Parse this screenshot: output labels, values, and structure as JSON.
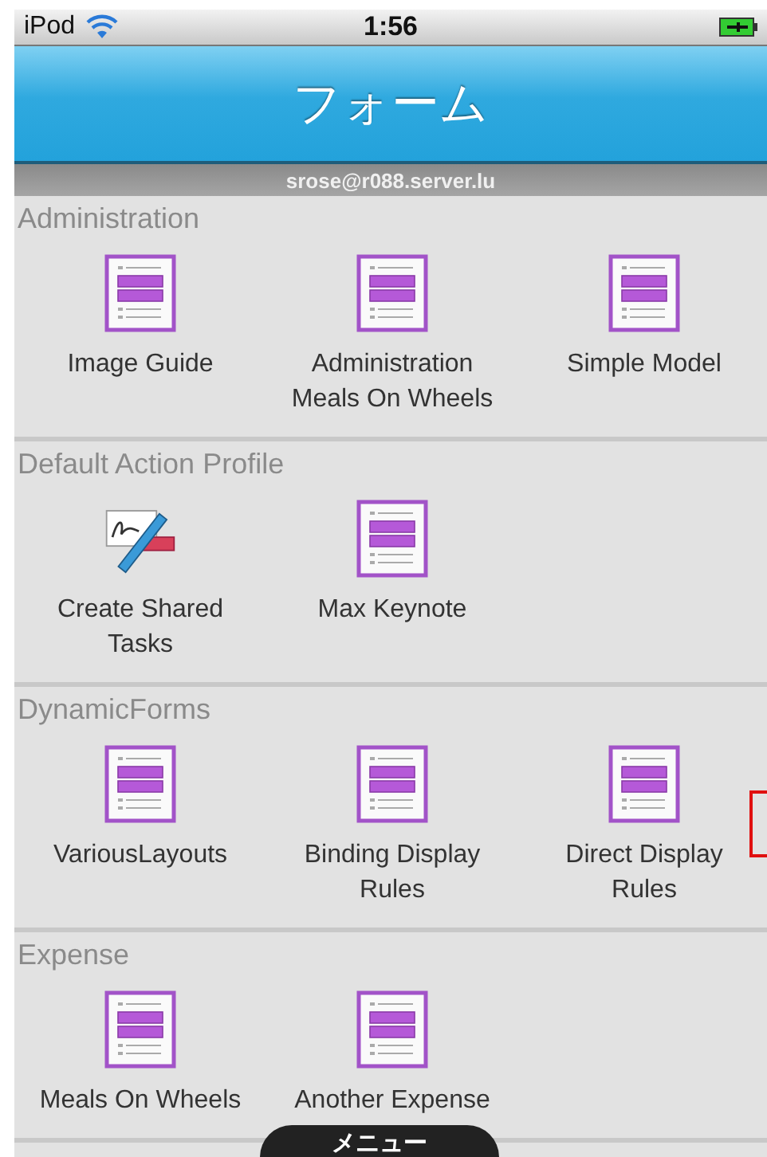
{
  "status_bar": {
    "carrier": "iPod",
    "time": "1:56"
  },
  "nav_bar": {
    "title": "フォーム"
  },
  "account": "srose@r088.server.lu",
  "sections": [
    {
      "title": "Administration",
      "items": [
        {
          "kind": "form",
          "label": "Image Guide"
        },
        {
          "kind": "form",
          "label": "Administration Meals On Wheels"
        },
        {
          "kind": "form",
          "label": "Simple Model"
        }
      ]
    },
    {
      "title": "Default Action Profile",
      "items": [
        {
          "kind": "signature",
          "label": "Create Shared Tasks"
        },
        {
          "kind": "form",
          "label": "Max Keynote"
        }
      ]
    },
    {
      "title": "DynamicForms",
      "items": [
        {
          "kind": "form",
          "label": "VariousLayouts"
        },
        {
          "kind": "form",
          "label": "Binding Display Rules"
        },
        {
          "kind": "form",
          "label": "Direct Display Rules"
        }
      ]
    },
    {
      "title": "Expense",
      "items": [
        {
          "kind": "form",
          "label": "Meals On Wheels"
        },
        {
          "kind": "form",
          "label": "Another Expense"
        }
      ]
    }
  ],
  "menu_tab": {
    "label": "メニュー"
  }
}
